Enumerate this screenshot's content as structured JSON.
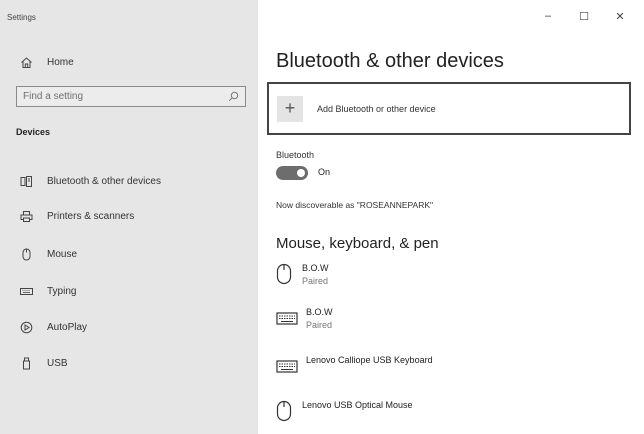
{
  "window": {
    "app_title": "Settings",
    "controls": {
      "minimize": "–",
      "maximize": "☐",
      "close": "✕"
    }
  },
  "sidebar": {
    "home_label": "Home",
    "search_placeholder": "Find a setting",
    "section_label": "Devices",
    "items": [
      {
        "label": "Bluetooth & other devices",
        "icon": "bluetooth-devices-icon"
      },
      {
        "label": "Printers & scanners",
        "icon": "printer-icon"
      },
      {
        "label": "Mouse",
        "icon": "mouse-icon"
      },
      {
        "label": "Typing",
        "icon": "keyboard-icon"
      },
      {
        "label": "AutoPlay",
        "icon": "autoplay-icon"
      },
      {
        "label": "USB",
        "icon": "usb-icon"
      }
    ]
  },
  "main": {
    "title": "Bluetooth & other devices",
    "add_device_label": "Add Bluetooth or other device",
    "bluetooth_label": "Bluetooth",
    "bluetooth_state": "On",
    "discoverable_text": "Now discoverable as \"ROSEANNEPARK\"",
    "devices_heading": "Mouse, keyboard, & pen",
    "devices": [
      {
        "name": "B.O.W",
        "status": "Paired",
        "icon": "mouse-icon"
      },
      {
        "name": "B.O.W",
        "status": "Paired",
        "icon": "keyboard-icon"
      },
      {
        "name": "Lenovo Calliope USB Keyboard",
        "status": "",
        "icon": "keyboard-icon"
      },
      {
        "name": "Lenovo USB Optical Mouse",
        "status": "",
        "icon": "mouse-icon"
      }
    ]
  },
  "colors": {
    "sidebar_bg": "#e6e6e6",
    "toggle_on": "#6d6d6d",
    "text": "#2b2b2b"
  }
}
